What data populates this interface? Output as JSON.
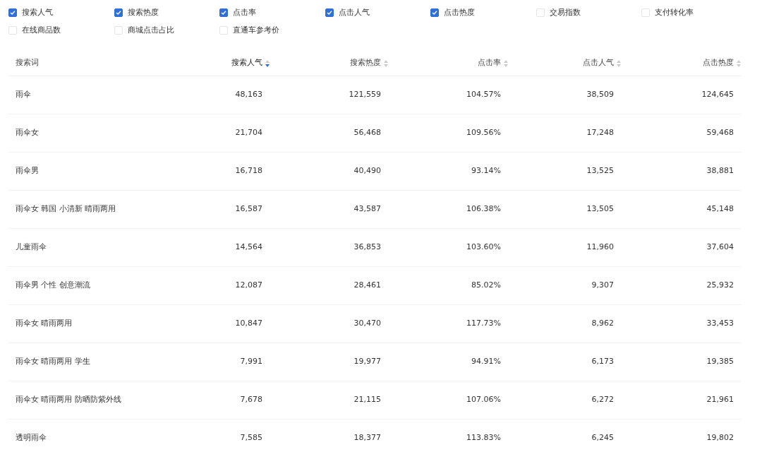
{
  "metrics": [
    {
      "label": "搜索人气",
      "checked": true
    },
    {
      "label": "搜索热度",
      "checked": true
    },
    {
      "label": "点击率",
      "checked": true
    },
    {
      "label": "点击人气",
      "checked": true
    },
    {
      "label": "点击热度",
      "checked": true
    },
    {
      "label": "交易指数",
      "checked": false
    },
    {
      "label": "支付转化率",
      "checked": false
    },
    {
      "label": "在线商品数",
      "checked": false
    },
    {
      "label": "商城点击占比",
      "checked": false
    },
    {
      "label": "直通车参考价",
      "checked": false
    }
  ],
  "table": {
    "columns": [
      {
        "label": "搜索词",
        "kind": "plain",
        "selected": false
      },
      {
        "label": "搜索人气",
        "kind": "sortable",
        "selected": true
      },
      {
        "label": "搜索热度",
        "kind": "sortable",
        "selected": false
      },
      {
        "label": "点击率",
        "kind": "sortable",
        "selected": false
      },
      {
        "label": "点击人气",
        "kind": "sortable",
        "selected": false
      },
      {
        "label": "点击热度",
        "kind": "sortable",
        "selected": false
      }
    ],
    "rows": [
      [
        "雨伞",
        "48,163",
        "121,559",
        "104.57%",
        "38,509",
        "124,645"
      ],
      [
        "雨伞女",
        "21,704",
        "56,468",
        "109.56%",
        "17,248",
        "59,468"
      ],
      [
        "雨伞男",
        "16,718",
        "40,490",
        "93.14%",
        "13,525",
        "38,881"
      ],
      [
        "雨伞女 韩国 小清新 晴雨两用",
        "16,587",
        "43,587",
        "106.38%",
        "13,505",
        "45,148"
      ],
      [
        "儿童雨伞",
        "14,564",
        "36,853",
        "103.60%",
        "11,960",
        "37,604"
      ],
      [
        "雨伞男 个性 创意潮流",
        "12,087",
        "28,461",
        "85.02%",
        "9,307",
        "25,932"
      ],
      [
        "雨伞女 晴雨两用",
        "10,847",
        "30,470",
        "117.73%",
        "8,962",
        "33,453"
      ],
      [
        "雨伞女 晴雨两用 学生",
        "7,991",
        "19,977",
        "94.91%",
        "6,173",
        "19,385"
      ],
      [
        "雨伞女 晴雨两用 防晒防紫外线",
        "7,678",
        "21,115",
        "107.06%",
        "6,272",
        "21,961"
      ],
      [
        "透明雨伞",
        "7,585",
        "18,377",
        "113.83%",
        "6,245",
        "19,802"
      ]
    ]
  }
}
